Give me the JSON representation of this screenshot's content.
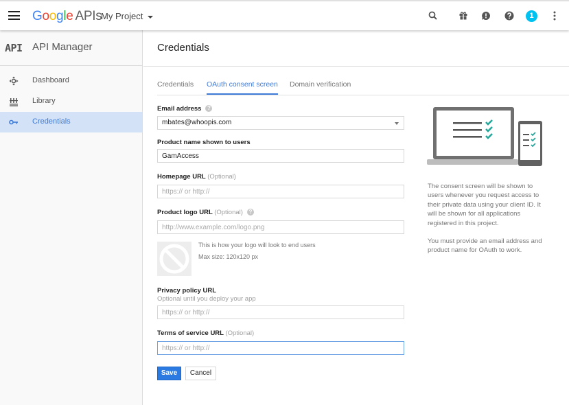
{
  "topbar": {
    "logo_google": [
      "G",
      "o",
      "o",
      "g",
      "l",
      "e"
    ],
    "logo_google_colors": [
      "#4285f4",
      "#ea4335",
      "#fbbc05",
      "#4285f4",
      "#34a853",
      "#ea4335"
    ],
    "logo_apis": "APIs",
    "project_name": "My Project",
    "notification_count": "1",
    "icons": [
      "search-icon",
      "gift-icon",
      "feedback-icon",
      "help-icon",
      "notifications-badge",
      "more-vert-icon"
    ]
  },
  "sidebar": {
    "badge": "API",
    "title": "API Manager",
    "items": [
      {
        "label": "Dashboard",
        "icon": "dashboard-icon",
        "active": false
      },
      {
        "label": "Library",
        "icon": "library-icon",
        "active": false
      },
      {
        "label": "Credentials",
        "icon": "key-icon",
        "active": true
      }
    ]
  },
  "main": {
    "page_title": "Credentials",
    "tabs": [
      {
        "label": "Credentials",
        "active": false
      },
      {
        "label": "OAuth consent screen",
        "active": true
      },
      {
        "label": "Domain verification",
        "active": false
      }
    ],
    "form": {
      "email": {
        "label": "Email address",
        "value": "mbates@whoopis.com"
      },
      "product_name": {
        "label": "Product name shown to users",
        "value": "GamAccess"
      },
      "homepage": {
        "label": "Homepage URL",
        "optional": "(Optional)",
        "placeholder": "https:// or http://"
      },
      "logo_url": {
        "label": "Product logo URL",
        "optional": "(Optional)",
        "placeholder": "http://www.example.com/logo.png"
      },
      "logo_note_1": "This is how your logo will look to end users",
      "logo_note_2": "Max size: 120x120 px",
      "privacy": {
        "label": "Privacy policy URL",
        "help": "Optional until you deploy your app",
        "placeholder": "https:// or http://"
      },
      "terms": {
        "label": "Terms of service URL",
        "optional": "(Optional)",
        "placeholder": "https:// or http://"
      },
      "save_label": "Save",
      "cancel_label": "Cancel"
    },
    "info": {
      "paragraph_1": "The consent screen will be shown to users whenever you request access to their private data using your client ID. It will be shown for all applications registered in this project.",
      "paragraph_2": "You must provide an email address and product name for OAuth to work."
    },
    "colors": {
      "accent": "#3e7ad8",
      "check": "#26a69a",
      "save_button": "#2a7ae2"
    }
  }
}
